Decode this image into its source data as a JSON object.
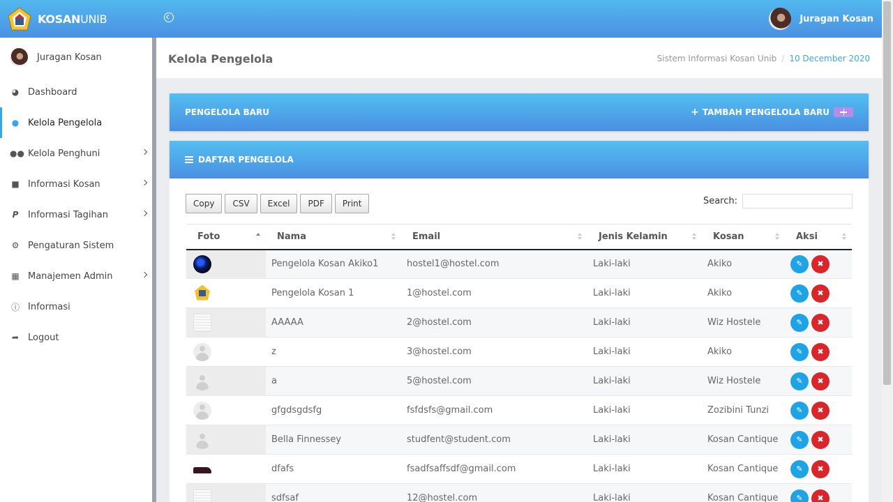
{
  "brand": {
    "bold": "KOSAN",
    "light": "UNIB"
  },
  "header": {
    "user_name": "Juragan Kosan"
  },
  "sidebar": {
    "user_name": "Juragan Kosan",
    "items": [
      {
        "label": "Dashboard",
        "icon": "dashboard-icon"
      },
      {
        "label": "Kelola Pengelola",
        "icon": "user-icon"
      },
      {
        "label": "Kelola Penghuni",
        "icon": "users-icon"
      },
      {
        "label": "Informasi Kosan",
        "icon": "bank-icon"
      },
      {
        "label": "Informasi Tagihan",
        "icon": "paypal-icon"
      },
      {
        "label": "Pengaturan Sistem",
        "icon": "cogs-icon"
      },
      {
        "label": "Manajemen Admin",
        "icon": "cubes-icon"
      },
      {
        "label": "Informasi",
        "icon": "info-icon"
      },
      {
        "label": "Logout",
        "icon": "logout-icon"
      }
    ]
  },
  "page": {
    "title": "Kelola Pengelola",
    "breadcrumb_site": "Sistem Informasi Kosan Unib",
    "breadcrumb_sep": "/",
    "date": "10 December 2020"
  },
  "card_new": {
    "title": "PENGELOLA BARU",
    "add_label": "TAMBAH PENGELOLA BARU"
  },
  "card_list": {
    "title": "DAFTAR PENGELOLA"
  },
  "export_buttons": [
    "Copy",
    "CSV",
    "Excel",
    "PDF",
    "Print"
  ],
  "search": {
    "label": "Search:",
    "value": ""
  },
  "table": {
    "columns": [
      "Foto",
      "Nama",
      "Email",
      "Jenis Kelamin",
      "Kosan",
      "Aksi"
    ],
    "rows": [
      {
        "nama": "Pengelola Kosan Akiko1",
        "email": "hostel1@hostel.com",
        "jk": "Laki-laki",
        "kosan": "Akiko"
      },
      {
        "nama": "Pengelola Kosan 1",
        "email": "1@hostel.com",
        "jk": "Laki-laki",
        "kosan": "Akiko"
      },
      {
        "nama": "AAAAA",
        "email": "2@hostel.com",
        "jk": "Laki-laki",
        "kosan": "Wiz Hostele"
      },
      {
        "nama": "z",
        "email": "3@hostel.com",
        "jk": "Laki-laki",
        "kosan": "Akiko"
      },
      {
        "nama": "a",
        "email": "5@hostel.com",
        "jk": "Laki-laki",
        "kosan": "Wiz Hostele"
      },
      {
        "nama": "gfgdsgdsfg",
        "email": "fsfdsfs@gmail.com",
        "jk": "Laki-laki",
        "kosan": "Zozibini Tunzi"
      },
      {
        "nama": "Bella Finnessey",
        "email": "studfent@student.com",
        "jk": "Laki-laki",
        "kosan": "Kosan Cantique"
      },
      {
        "nama": "dfafs",
        "email": "fsadfsaffsdf@gmail.com",
        "jk": "Laki-laki",
        "kosan": "Kosan Cantique"
      },
      {
        "nama": "sdfsaf",
        "email": "12@hostel.com",
        "jk": "Laki-laki",
        "kosan": "Kosan Cantique"
      }
    ]
  },
  "colors": {
    "accent": "#3aa6e8",
    "edit": "#1ea3e6",
    "delete": "#d9262b"
  }
}
